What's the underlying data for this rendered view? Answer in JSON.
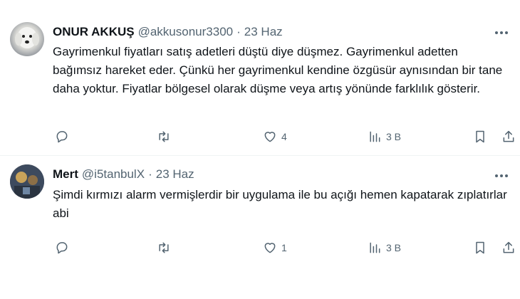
{
  "tweets": [
    {
      "name": "ONUR AKKUŞ",
      "handle": "@akkusonur3300",
      "separator": "·",
      "date": "23 Haz",
      "text": "Gayrimenkul fiyatları satış adetleri düştü diye düşmez. Gayrimenkul adetten bağımsız hareket eder. Çünkü her gayrimenkul kendine özgüsür aynısından bir tane daha yoktur. Fiyatlar bölgesel olarak düşme veya artış yönünde farklılık gösterir.",
      "replies": "",
      "retweets": "",
      "likes": "4",
      "views": "3 B"
    },
    {
      "name": "Mert",
      "handle": "@i5tanbulX",
      "separator": "·",
      "date": "23 Haz",
      "text": "Şimdi kırmızı alarm vermişlerdir bir uygulama ile bu açığı hemen kapatarak zıplatırlar abi",
      "replies": "",
      "retweets": "",
      "likes": "1",
      "views": "3 B"
    }
  ],
  "icons": {
    "more": "more-icon",
    "reply": "reply-icon",
    "retweet": "retweet-icon",
    "like": "heart-icon",
    "views": "views-icon",
    "bookmark": "bookmark-icon",
    "share": "share-icon"
  },
  "colors": {
    "text": "#0f1419",
    "secondary": "#536471",
    "divider": "#eff3f4"
  }
}
